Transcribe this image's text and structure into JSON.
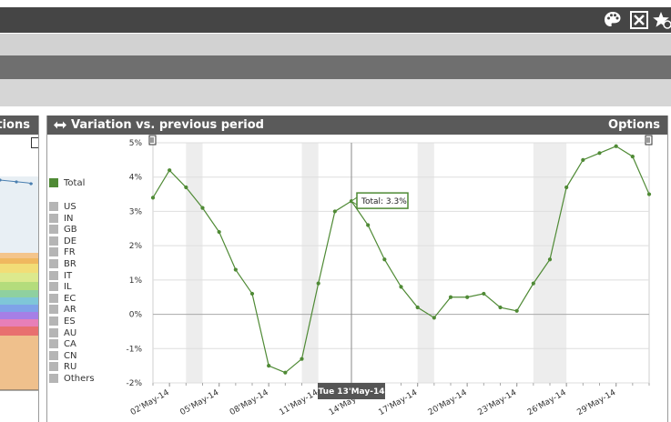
{
  "toolbar": {
    "icons": [
      "palette-icon",
      "export-excel-icon",
      "favorite-settings-icon"
    ]
  },
  "left_panel": {
    "header_fragment": "tions"
  },
  "panel": {
    "title": "Variation vs. previous period",
    "options_label": "Options",
    "expand_icon": "expand-arrows-icon"
  },
  "legend": {
    "total": {
      "label": "Total",
      "color": "#4f8a35"
    },
    "items": [
      "US",
      "IN",
      "GB",
      "DE",
      "FR",
      "BR",
      "IT",
      "IL",
      "EC",
      "AR",
      "ES",
      "AU",
      "CA",
      "CN",
      "RU",
      "Others"
    ],
    "inactive_color": "#b5b5b5"
  },
  "tooltip": {
    "text": "Total: 3.3%",
    "crosshair_label": "Tue 13'May-14"
  },
  "chart_data": {
    "type": "line",
    "series": [
      {
        "name": "Total",
        "color": "#4f8a35",
        "x": [
          "01'May-14",
          "02'May-14",
          "03'May-14",
          "04'May-14",
          "05'May-14",
          "06'May-14",
          "07'May-14",
          "08'May-14",
          "09'May-14",
          "10'May-14",
          "11'May-14",
          "12'May-14",
          "13'May-14",
          "14'May-14",
          "15'May-14",
          "16'May-14",
          "17'May-14",
          "18'May-14",
          "19'May-14",
          "20'May-14",
          "21'May-14",
          "22'May-14",
          "23'May-14",
          "24'May-14",
          "25'May-14",
          "26'May-14",
          "27'May-14",
          "28'May-14",
          "29'May-14",
          "30'May-14",
          "31'May-14"
        ],
        "values": [
          3.4,
          4.2,
          3.7,
          3.1,
          2.4,
          1.3,
          0.6,
          -1.5,
          -1.7,
          -1.3,
          0.9,
          3.0,
          3.3,
          2.6,
          1.6,
          0.8,
          0.2,
          -0.1,
          0.5,
          0.5,
          0.6,
          0.2,
          0.1,
          0.9,
          1.6,
          3.7,
          4.5,
          4.7,
          4.9,
          4.6,
          3.5
        ]
      }
    ],
    "x_tick_labels": [
      "02'May-14",
      "05'May-14",
      "08'May-14",
      "11'May-14",
      "14'May-14",
      "17'May-14",
      "20'May-14",
      "23'May-14",
      "26'May-14",
      "29'May-14"
    ],
    "y_tick_labels": [
      "-2%",
      "-1%",
      "0%",
      "1%",
      "2%",
      "3%",
      "4%",
      "5%"
    ],
    "y_ticks": [
      -2,
      -1,
      0,
      1,
      2,
      3,
      4,
      5
    ],
    "ylim": [
      -2,
      5
    ],
    "weekend_bands": [
      [
        "03'May-14",
        "04'May-14"
      ],
      [
        "10'May-14",
        "11'May-14"
      ],
      [
        "17'May-14",
        "18'May-14"
      ],
      [
        "24'May-14",
        "25'May-14"
      ],
      [
        "25'May-14",
        "26'May-14"
      ]
    ],
    "grid": true,
    "legend_position": "left"
  }
}
